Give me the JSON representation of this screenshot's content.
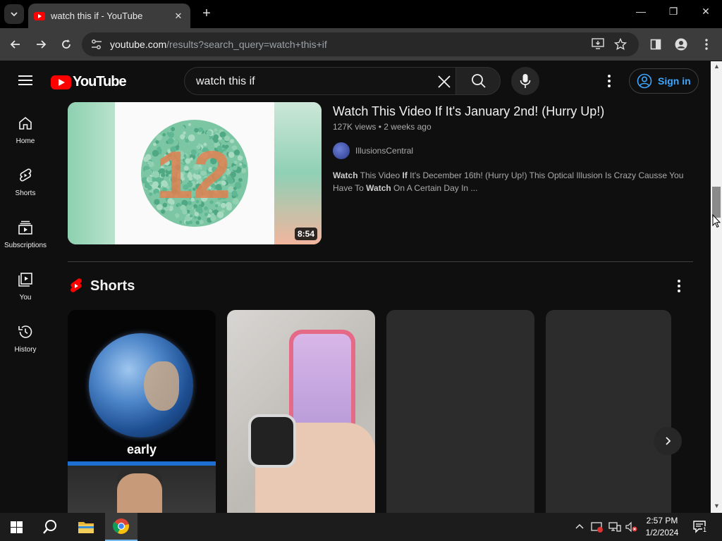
{
  "browser": {
    "tab_title": "watch this if - YouTube",
    "url_host": "youtube.com",
    "url_path": "/results?search_query=watch+this+if"
  },
  "masthead": {
    "logo_text": "YouTube",
    "search_value": "watch this if",
    "signin_label": "Sign in"
  },
  "guide": {
    "items": [
      {
        "label": "Home",
        "icon": "home-icon"
      },
      {
        "label": "Shorts",
        "icon": "shorts-icon"
      },
      {
        "label": "Subscriptions",
        "icon": "subscriptions-icon"
      },
      {
        "label": "You",
        "icon": "you-icon"
      },
      {
        "label": "History",
        "icon": "history-icon"
      }
    ]
  },
  "video": {
    "title": "Watch This Video If It's January 2nd! (Hurry Up!)",
    "views": "127K views",
    "age": "2 weeks ago",
    "channel": "IllusionsCentral",
    "duration": "8:54",
    "thumbnail_number": "12",
    "description_parts": [
      {
        "text": "Watch",
        "bold": true
      },
      {
        "text": " This Video ",
        "bold": false
      },
      {
        "text": "If",
        "bold": true
      },
      {
        "text": " It's December 16th! (Hurry Up!) This Optical Illusion Is Crazy Causse You Have To ",
        "bold": false
      },
      {
        "text": "Watch",
        "bold": true
      },
      {
        "text": " On A Certain Day In ...",
        "bold": false
      }
    ]
  },
  "shorts": {
    "heading": "Shorts",
    "items": [
      {
        "overlay_text": "early"
      },
      {
        "overlay_text": ""
      },
      {
        "overlay_text": ""
      },
      {
        "overlay_text": ""
      }
    ]
  },
  "taskbar": {
    "time": "2:57 PM",
    "date": "1/2/2024",
    "notification_count": "1"
  },
  "colors": {
    "youtube_red": "#ff0000",
    "signin_blue": "#3ea6ff",
    "background": "#0f0f0f"
  }
}
